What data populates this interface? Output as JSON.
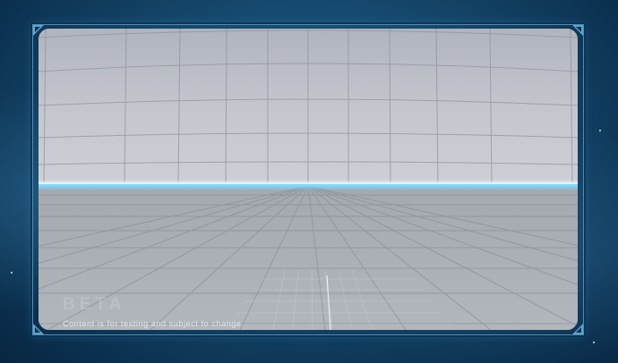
{
  "watermark": {
    "beta_label": "BETA",
    "disclaimer": "Content is for testing and subject to change"
  },
  "colors": {
    "frame_border": "#4c8db5",
    "horizon_glow": "#7fd8ff",
    "background": "#164a6e"
  },
  "icons": {
    "corners": [
      "corner-ornament-icon",
      "corner-ornament-icon",
      "corner-ornament-icon",
      "corner-ornament-icon"
    ]
  }
}
